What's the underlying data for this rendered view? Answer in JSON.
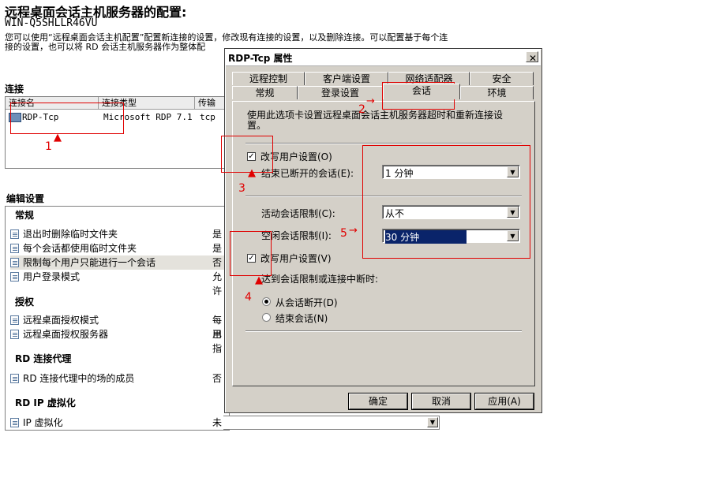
{
  "console": {
    "title": "远程桌面会话主机服务器的配置:",
    "server_name": "WIN-Q5SHLLR46VU",
    "description_line1": "您可以使用“远程桌面会话主机配置”配置新连接的设置，修改现有连接的设置，以及删除连接。可以配置基于每个连",
    "description_line2": "接的设置，也可以将 RD 会话主机服务器作为整体配",
    "connections_heading": "连接",
    "columns": [
      "连接名",
      "连接类型",
      "传输"
    ],
    "connection_row": {
      "name": "RDP-Tcp",
      "type": "Microsoft RDP 7.1",
      "transport": "tcp"
    },
    "edit_heading": "编辑设置",
    "groups": [
      {
        "title": "常规",
        "items": [
          {
            "label": "退出时删除临时文件夹",
            "value": "是"
          },
          {
            "label": "每个会话都使用临时文件夹",
            "value": "是"
          },
          {
            "label": "限制每个用户只能进行一个会话",
            "value": "否"
          },
          {
            "label": "用户登录模式",
            "value": "允许"
          }
        ]
      },
      {
        "title": "授权",
        "items": [
          {
            "label": "远程桌面授权模式",
            "value": "每用"
          },
          {
            "label": "远程桌面授权服务器",
            "value": "已指"
          }
        ]
      },
      {
        "title": "RD 连接代理",
        "items": [
          {
            "label": "RD 连接代理中的场的成员",
            "value": "否"
          }
        ]
      },
      {
        "title": "RD IP 虚拟化",
        "items": [
          {
            "label": "IP 虚拟化",
            "value": "未启用"
          }
        ]
      }
    ]
  },
  "dialog": {
    "title": "RDP-Tcp 属性",
    "close_glyph": "✕",
    "tabs_back": [
      "远程控制",
      "客户端设置",
      "网络适配器",
      "安全"
    ],
    "tabs_front": [
      "常规",
      "登录设置",
      "会话",
      "环境"
    ],
    "description": "使用此选项卡设置远程桌面会话主机服务器超时和重新连接设置。",
    "override1_label": "改写用户设置(O)",
    "end_disconnected_label": "结束已断开的会话(E):",
    "end_disconnected_value": "1 分钟",
    "active_limit_label": "活动会话限制(C):",
    "active_limit_value": "从不",
    "idle_limit_label": "空闲会话限制(I):",
    "idle_limit_value": "30 分钟",
    "override2_label": "改写用户设置(V)",
    "limit_reached_label": "达到会话限制或连接中断时:",
    "radio1_label": "从会话断开(D)",
    "radio2_label": "结束会话(N)",
    "buttons": {
      "ok": "确定",
      "cancel": "取消",
      "apply": "应用(A)"
    }
  },
  "annotations": [
    "1",
    "2",
    "3",
    "4",
    "5"
  ],
  "colors": {
    "annotation": "#e00000",
    "dialog_face": "#d4d0c8",
    "selection": "#0a246a"
  }
}
